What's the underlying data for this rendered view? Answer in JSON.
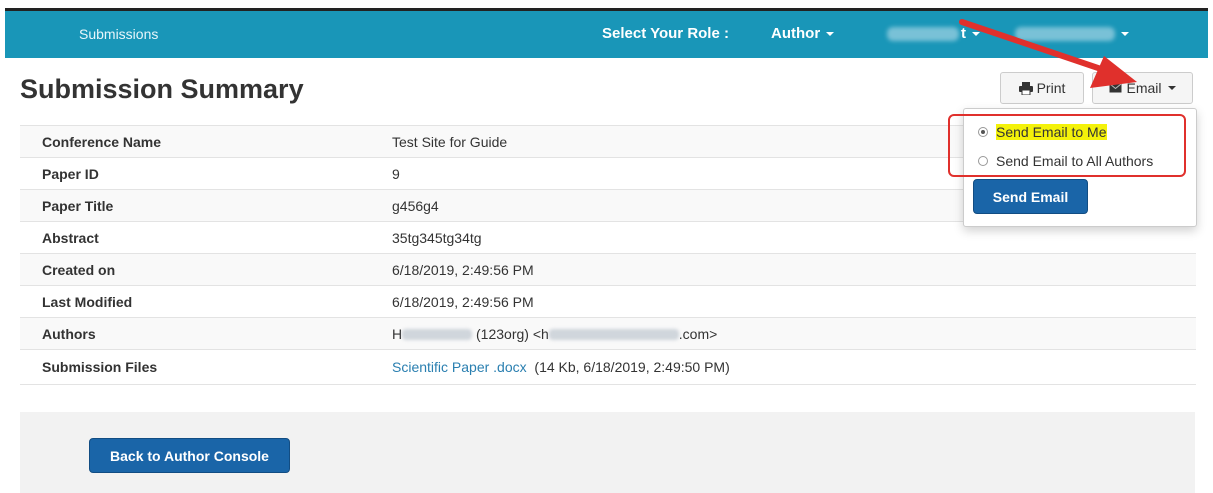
{
  "header": {
    "nav_submissions": "Submissions",
    "role_label": "Select Your Role :",
    "role_value": "Author",
    "user_suffix": "t"
  },
  "page": {
    "title": "Submission Summary"
  },
  "actions": {
    "print_label": "Print",
    "email_label": "Email"
  },
  "summary_rows": [
    {
      "key": "Conference Name",
      "value": "Test Site for Guide"
    },
    {
      "key": "Paper ID",
      "value": "9"
    },
    {
      "key": "Paper Title",
      "value": "g456g4"
    },
    {
      "key": "Abstract",
      "value": "35tg345tg34tg"
    },
    {
      "key": "Created on",
      "value": "6/18/2019, 2:49:56 PM"
    },
    {
      "key": "Last Modified",
      "value": "6/18/2019, 2:49:56 PM"
    },
    {
      "key": "Authors",
      "value_prefix": "H",
      "value_middle": "(123org) <h",
      "value_suffix": ".com>"
    },
    {
      "key": "Submission Files",
      "file_link": "Scientific Paper .docx",
      "file_meta": "(14 Kb, 6/18/2019, 2:49:50 PM)"
    }
  ],
  "email_menu": {
    "option_me": "Send Email to Me",
    "option_all": "Send Email to All Authors",
    "send_button": "Send Email"
  },
  "footer": {
    "back_button": "Back to Author Console"
  },
  "colors": {
    "topbar": "#1996b8",
    "primary": "#1a65a8",
    "annotation": "#e0302c",
    "highlight": "#f4f20a"
  }
}
